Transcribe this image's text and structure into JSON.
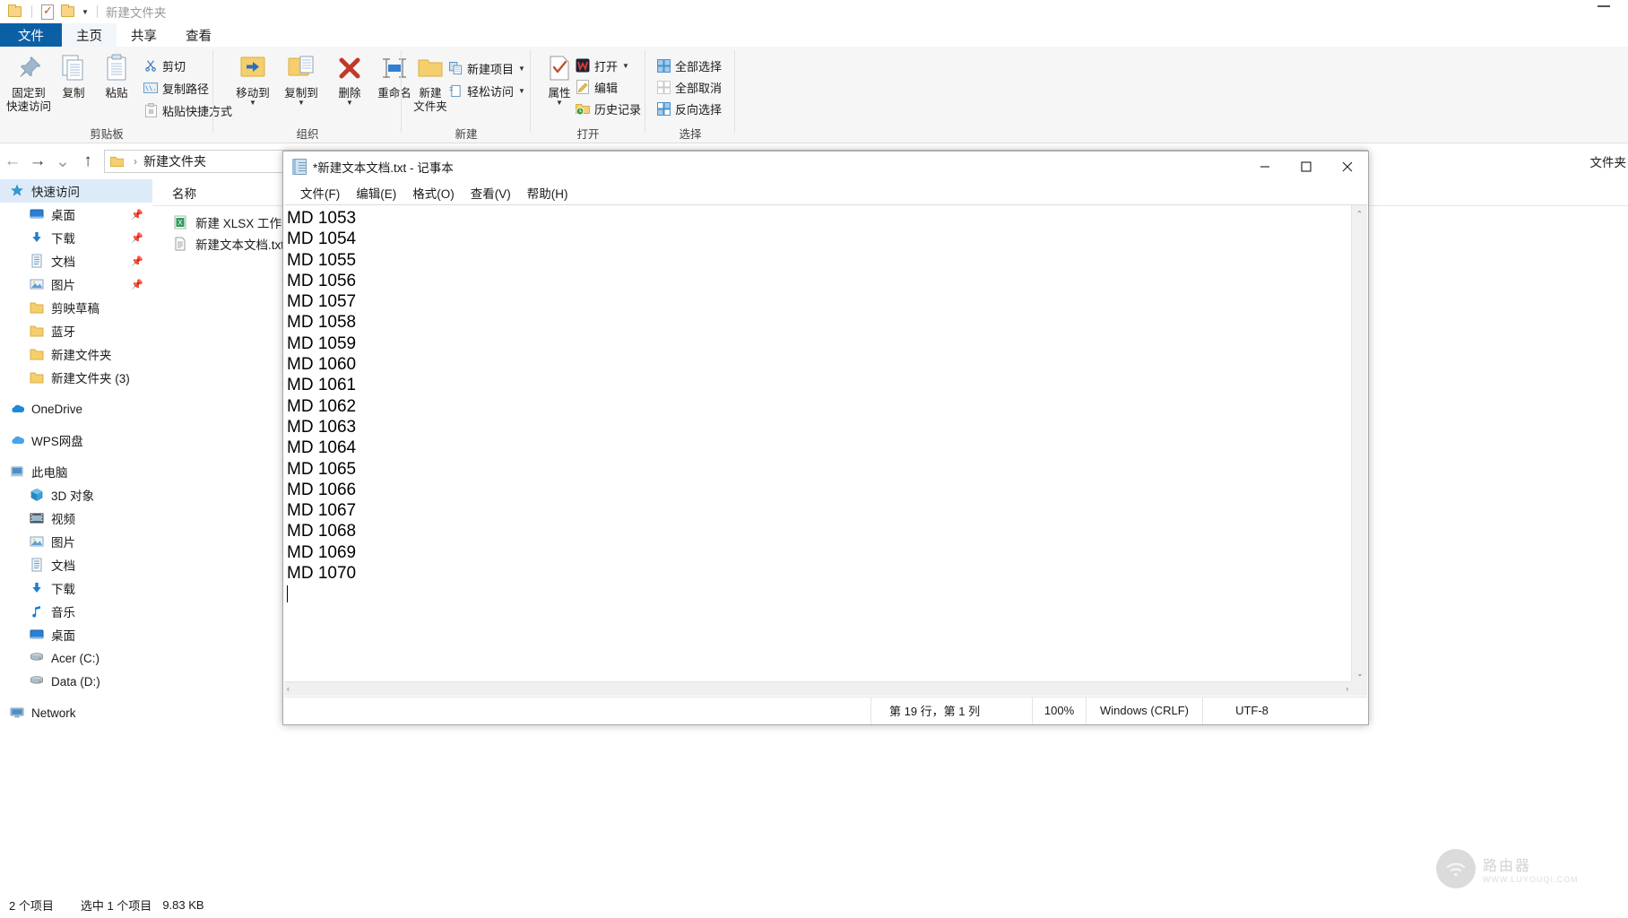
{
  "explorer": {
    "quick_access": {
      "folder_icon": "folder-icon",
      "properties_icon": "properties-icon",
      "newfolder_icon": "new-folder-icon",
      "customize_caret": "chevron-down-icon"
    },
    "title": "新建文件夹",
    "minimize_label": "—",
    "tabs": [
      {
        "label": "文件",
        "kind": "file"
      },
      {
        "label": "主页",
        "kind": "active"
      },
      {
        "label": "共享",
        "kind": "normal"
      },
      {
        "label": "查看",
        "kind": "normal"
      }
    ],
    "ribbon": {
      "groups": [
        {
          "label": "剪贴板"
        },
        {
          "label": "组织"
        },
        {
          "label": "新建"
        },
        {
          "label": "打开"
        },
        {
          "label": "选择"
        }
      ],
      "clipboard": {
        "pin": {
          "line1": "固定到",
          "line2": "快速访问",
          "icon": "pin-icon"
        },
        "copy": {
          "label": "复制",
          "icon": "copy-icon"
        },
        "paste": {
          "label": "粘贴",
          "icon": "paste-icon"
        },
        "cut": {
          "label": "剪切",
          "icon": "scissors-icon"
        },
        "copy_path": {
          "label": "复制路径",
          "icon": "copy-path-icon"
        },
        "paste_shortcut": {
          "label": "粘贴快捷方式",
          "icon": "paste-shortcut-icon"
        }
      },
      "organize": {
        "move_to": {
          "label": "移动到",
          "icon": "move-to-icon"
        },
        "copy_to": {
          "label": "复制到",
          "icon": "copy-to-icon"
        },
        "delete": {
          "label": "删除",
          "icon": "delete-x-icon"
        },
        "rename": {
          "label": "重命名",
          "icon": "rename-icon"
        }
      },
      "new": {
        "new_folder": {
          "line1": "新建",
          "line2": "文件夹",
          "icon": "new-folder-icon"
        },
        "new_item": {
          "label": "新建项目",
          "icon": "new-item-icon"
        },
        "easy_access": {
          "label": "轻松访问",
          "icon": "easy-access-icon"
        }
      },
      "open": {
        "properties": {
          "label": "属性",
          "icon": "properties-check-icon"
        },
        "open": {
          "label": "打开",
          "icon": "wps-open-icon"
        },
        "edit": {
          "label": "编辑",
          "icon": "edit-pencil-icon"
        },
        "history": {
          "label": "历史记录",
          "icon": "history-icon"
        }
      },
      "select": {
        "select_all": {
          "label": "全部选择",
          "icon": "select-all-icon"
        },
        "select_none": {
          "label": "全部取消",
          "icon": "select-none-icon"
        },
        "invert": {
          "label": "反向选择",
          "icon": "invert-selection-icon"
        }
      }
    },
    "address": {
      "back": "←",
      "forward": "→",
      "recent": "⌄",
      "up": "↑",
      "crumb_icon": "folder-icon",
      "crumb_sep": "›",
      "path": "新建文件夹"
    },
    "sidebar": [
      {
        "label": "快速访问",
        "icon": "star-pin-icon",
        "selected": true,
        "indent": 0,
        "pin": ""
      },
      {
        "label": "桌面",
        "icon": "desktop-icon",
        "selected": false,
        "indent": 1,
        "pin": "📌"
      },
      {
        "label": "下载",
        "icon": "download-icon",
        "selected": false,
        "indent": 1,
        "pin": "📌"
      },
      {
        "label": "文档",
        "icon": "document-icon",
        "selected": false,
        "indent": 1,
        "pin": "📌"
      },
      {
        "label": "图片",
        "icon": "pictures-icon",
        "selected": false,
        "indent": 1,
        "pin": "📌"
      },
      {
        "label": "剪映草稿",
        "icon": "folder-icon",
        "selected": false,
        "indent": 1,
        "pin": ""
      },
      {
        "label": "蓝牙",
        "icon": "folder-icon",
        "selected": false,
        "indent": 1,
        "pin": ""
      },
      {
        "label": "新建文件夹",
        "icon": "folder-icon",
        "selected": false,
        "indent": 1,
        "pin": ""
      },
      {
        "label": "新建文件夹 (3)",
        "icon": "folder-icon",
        "selected": false,
        "indent": 1,
        "pin": ""
      },
      {
        "gap": true
      },
      {
        "label": "OneDrive",
        "icon": "onedrive-cloud-icon",
        "selected": false,
        "indent": 0,
        "pin": ""
      },
      {
        "gap": true
      },
      {
        "label": "WPS网盘",
        "icon": "wps-cloud-icon",
        "selected": false,
        "indent": 0,
        "pin": ""
      },
      {
        "gap": true
      },
      {
        "label": "此电脑",
        "icon": "this-pc-icon",
        "selected": false,
        "indent": 0,
        "pin": ""
      },
      {
        "label": "3D 对象",
        "icon": "3d-objects-icon",
        "selected": false,
        "indent": 1,
        "pin": ""
      },
      {
        "label": "视频",
        "icon": "videos-icon",
        "selected": false,
        "indent": 1,
        "pin": ""
      },
      {
        "label": "图片",
        "icon": "pictures-icon",
        "selected": false,
        "indent": 1,
        "pin": ""
      },
      {
        "label": "文档",
        "icon": "document-icon",
        "selected": false,
        "indent": 1,
        "pin": ""
      },
      {
        "label": "下载",
        "icon": "download-icon",
        "selected": false,
        "indent": 1,
        "pin": ""
      },
      {
        "label": "音乐",
        "icon": "music-note-icon",
        "selected": false,
        "indent": 1,
        "pin": ""
      },
      {
        "label": "桌面",
        "icon": "desktop-icon",
        "selected": false,
        "indent": 1,
        "pin": ""
      },
      {
        "label": "Acer (C:)",
        "icon": "drive-icon",
        "selected": false,
        "indent": 1,
        "pin": ""
      },
      {
        "label": "Data (D:)",
        "icon": "drive-icon",
        "selected": false,
        "indent": 1,
        "pin": ""
      },
      {
        "gap": true
      },
      {
        "label": "Network",
        "icon": "network-icon",
        "selected": false,
        "indent": 0,
        "pin": ""
      }
    ],
    "column_header": "名称",
    "files": [
      {
        "name": "新建 XLSX 工作表",
        "icon": "xlsx-file-icon"
      },
      {
        "name": "新建文本文档.txt",
        "icon": "txt-file-icon"
      }
    ],
    "right_ghost_label": "文件夹",
    "status": {
      "count": "2 个项目",
      "selected": "选中 1 个项目",
      "size": "9.83 KB"
    }
  },
  "notepad": {
    "title": "*新建文本文档.txt - 记事本",
    "title_icon": "notepad-icon",
    "window_controls": {
      "minimize": "minimize-icon",
      "maximize": "maximize-icon",
      "close": "close-icon"
    },
    "menus": [
      {
        "label": "文件(F)"
      },
      {
        "label": "编辑(E)"
      },
      {
        "label": "格式(O)"
      },
      {
        "label": "查看(V)"
      },
      {
        "label": "帮助(H)"
      }
    ],
    "content_lines": [
      "MD 1053",
      "MD 1054",
      "MD 1055",
      "MD 1056",
      "MD 1057",
      "MD 1058",
      "MD 1059",
      "MD 1060",
      "MD 1061",
      "MD 1062",
      "MD 1063",
      "MD 1064",
      "MD 1065",
      "MD 1066",
      "MD 1067",
      "MD 1068",
      "MD 1069",
      "MD 1070"
    ],
    "scroll": {
      "up_arrow": "⌃",
      "down_arrow": "⌄",
      "left_arrow": "‹",
      "right_arrow": "›"
    },
    "status": {
      "caret_position": "第 19 行，第 1 列",
      "zoom": "100%",
      "line_ending": "Windows (CRLF)",
      "encoding": "UTF-8"
    }
  },
  "watermark": {
    "line1": "路由器",
    "line2": "WWW.LUYOUQI.COM",
    "icon": "wifi-icon"
  },
  "colors": {
    "accent_blue": "#0b5fa5",
    "selection_blue": "#ddebf9",
    "ribbon_bg": "#f6f6f6",
    "folder_yellow": "#f7d486"
  }
}
